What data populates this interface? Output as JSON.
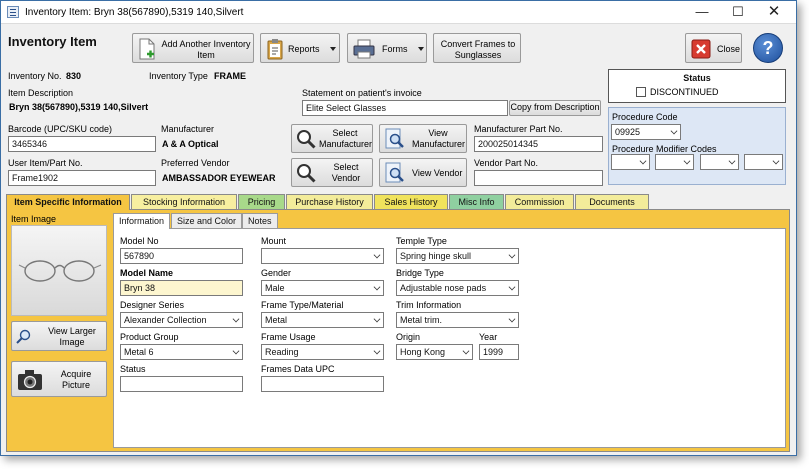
{
  "window": {
    "title": "Inventory Item:  Bryn 38(567890),5319 140,Silvert",
    "controls": [
      "minimize-icon",
      "maximize-icon",
      "close-icon"
    ]
  },
  "header": {
    "heading": "Inventory Item",
    "buttons": {
      "add_another": "Add Another Inventory Item",
      "reports": "Reports",
      "forms": "Forms",
      "convert": "Convert Frames to Sunglasses",
      "close": "Close",
      "help": "?"
    }
  },
  "summary": {
    "inventory_no_label": "Inventory No.",
    "inventory_no": "830",
    "inventory_type_label": "Inventory Type",
    "inventory_type": "FRAME",
    "item_description_label": "Item Description",
    "item_description": "Bryn 38(567890),5319 140,Silvert",
    "statement_label": "Statement on patient's invoice",
    "statement_value": "Elite Select Glasses",
    "copy_button": "Copy from Description",
    "barcode_label": "Barcode (UPC/SKU code)",
    "barcode": "3465346",
    "manufacturer_label": "Manufacturer",
    "manufacturer": "A & A Optical",
    "user_item_label": "User Item/Part No.",
    "user_item": "Frame1902",
    "preferred_vendor_label": "Preferred Vendor",
    "preferred_vendor": "AMBASSADOR EYEWEAR",
    "select_manufacturer": "Select Manufacturer",
    "view_manufacturer": "View Manufacturer",
    "select_vendor": "Select Vendor",
    "view_vendor": "View Vendor",
    "mfr_part_label": "Manufacturer Part No.",
    "mfr_part": "200025014345",
    "vendor_part_label": "Vendor Part No.",
    "vendor_part": ""
  },
  "status": {
    "title": "Status",
    "discontinued_label": "DISCONTINUED",
    "discontinued": false
  },
  "procedure": {
    "code_label": "Procedure Code",
    "code": "09925",
    "modifiers_label": "Procedure Modifier Codes",
    "modifiers": [
      "",
      "",
      "",
      ""
    ]
  },
  "tabs": [
    {
      "label": "Item Specific Information",
      "color": "#f5c542"
    },
    {
      "label": "Stocking Information",
      "color": "#f7efa0"
    },
    {
      "label": "Pricing",
      "color": "#a8d98a"
    },
    {
      "label": "Purchase History",
      "color": "#f3ec9a"
    },
    {
      "label": "Sales History",
      "color": "#f0e35c"
    },
    {
      "label": "Misc Info",
      "color": "#8fd0a0"
    },
    {
      "label": "Commission",
      "color": "#f3ec9a"
    },
    {
      "label": "Documents",
      "color": "#f3ec9a"
    }
  ],
  "left_panel": {
    "item_image_label": "Item Image",
    "view_larger": "View Larger Image",
    "acquire": "Acquire Picture"
  },
  "inner_tabs": [
    "Information",
    "Size and Color",
    "Notes"
  ],
  "form": {
    "model_no_label": "Model No",
    "model_no": "567890",
    "model_name_label": "Model Name",
    "model_name": "Bryn 38",
    "designer_series_label": "Designer Series",
    "designer_series": "Alexander Collection",
    "product_group_label": "Product Group",
    "product_group": "Metal 6",
    "status_label": "Status",
    "status_value": "",
    "mount_label": "Mount",
    "mount": "",
    "gender_label": "Gender",
    "gender": "Male",
    "frame_type_label": "Frame Type/Material",
    "frame_type": "Metal",
    "frame_usage_label": "Frame Usage",
    "frame_usage": "Reading",
    "frames_upc_label": "Frames Data UPC",
    "frames_upc": "",
    "temple_type_label": "Temple Type",
    "temple_type": "Spring hinge skull",
    "bridge_type_label": "Bridge Type",
    "bridge_type": "Adjustable nose pads",
    "trim_label": "Trim Information",
    "trim": "Metal trim.",
    "origin_label": "Origin",
    "origin": "Hong Kong",
    "year_label": "Year",
    "year": "1999"
  }
}
